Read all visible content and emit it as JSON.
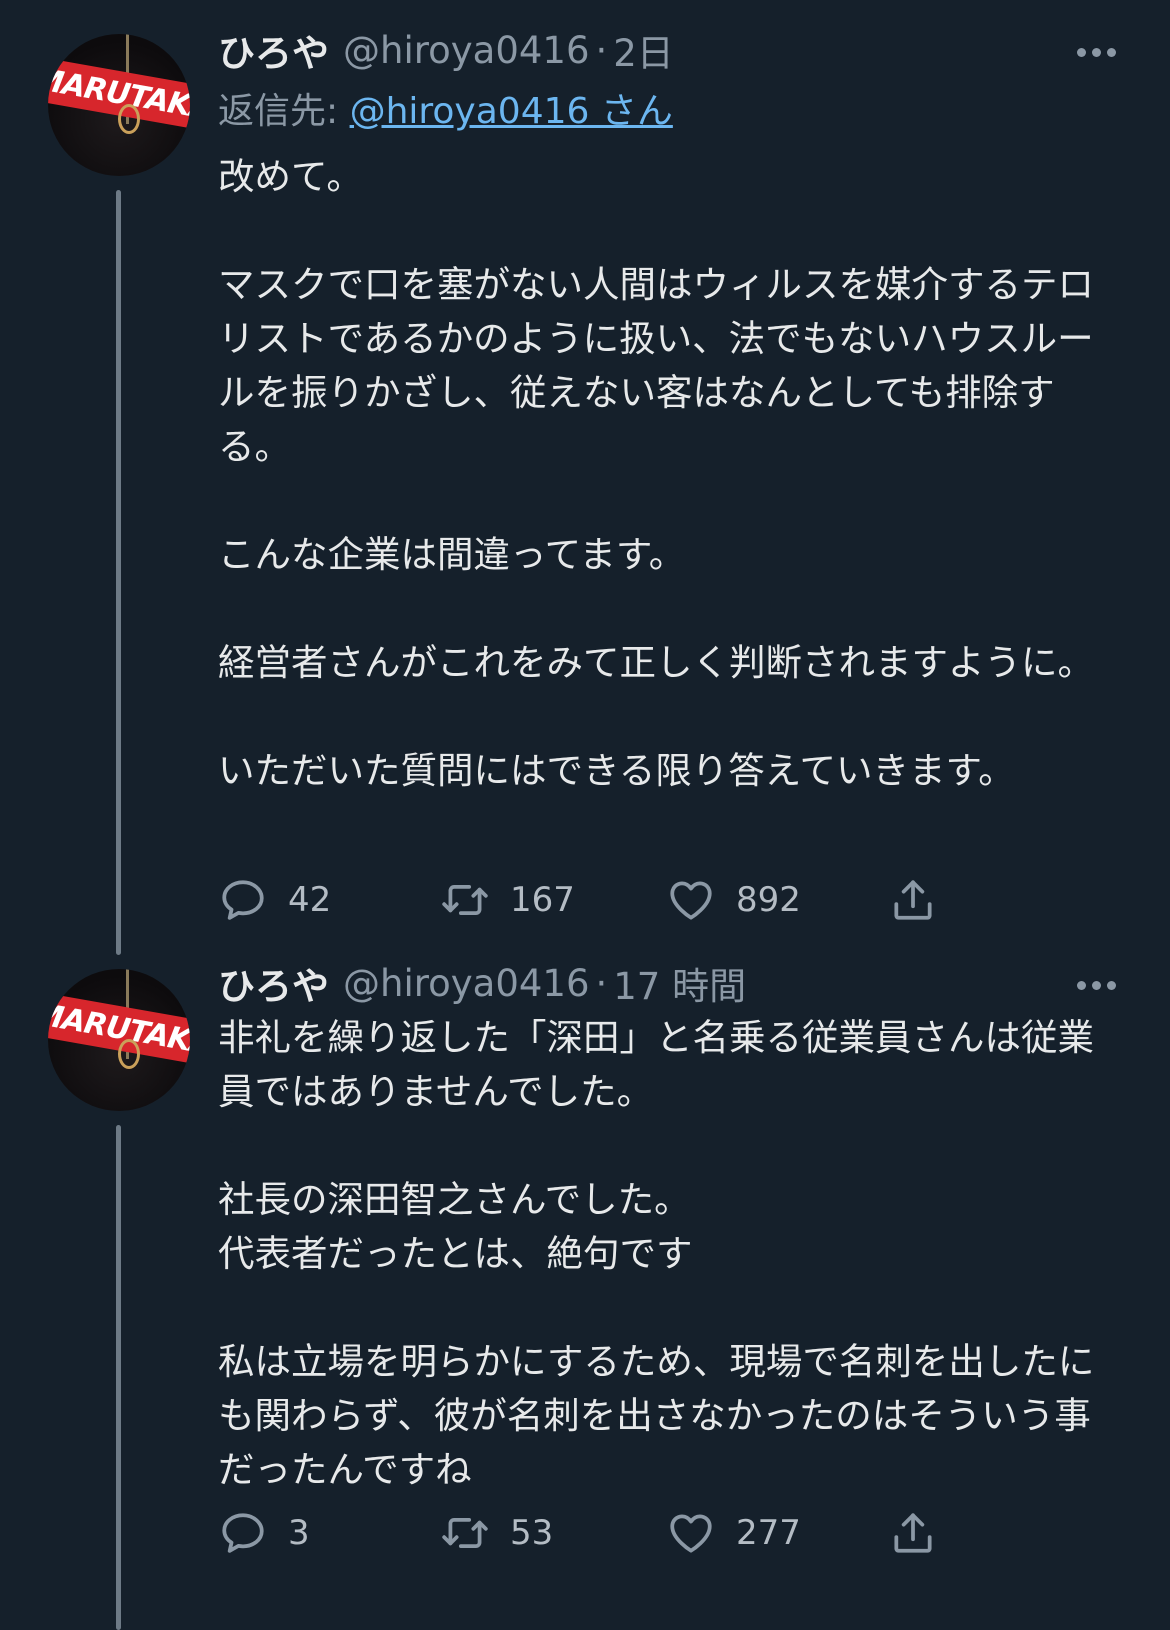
{
  "tweets": [
    {
      "avatar_text": "MARUTAKA",
      "name": "ひろや",
      "handle": "@hiroya0416",
      "separator": "·",
      "time": "2日",
      "reply_prefix": "返信先: ",
      "reply_handle": "@hiroya0416 さん",
      "body": "改めて。\n\nマスクで口を塞がない人間はウィルスを媒介するテロリストであるかのように扱い、法でもないハウスルールを振りかざし、従えない客はなんとしても排除する。\n\nこんな企業は間違ってます。\n\n経営者さんがこれをみて正しく判断されますように。\n\nいただいた質問にはできる限り答えていきます。",
      "replies": "42",
      "retweets": "167",
      "likes": "892"
    },
    {
      "avatar_text": "MARUTAKA",
      "name": "ひろや",
      "handle": "@hiroya0416",
      "separator": "·",
      "time": "17 時間",
      "body": "非礼を繰り返した「深田」と名乗る従業員さんは従業員ではありませんでした。\n\n社長の深田智之さんでした。\n代表者だったとは、絶句です\n\n私は立場を明らかにするため、現場で名刺を出したにも関わらず、彼が名刺を出さなかったのはそういう事だったんですね",
      "replies": "3",
      "retweets": "53",
      "likes": "277"
    }
  ],
  "icons": {
    "reply": "speech-bubble-icon",
    "retweet": "retweet-arrows-icon",
    "like": "heart-icon",
    "share": "share-upload-icon",
    "more": "more-dots-icon"
  },
  "colors": {
    "background": "#15202b",
    "text": "#e7e9ea",
    "muted": "#8b98a5",
    "link": "#6cb6f0",
    "avatar_band": "#d7262c"
  }
}
